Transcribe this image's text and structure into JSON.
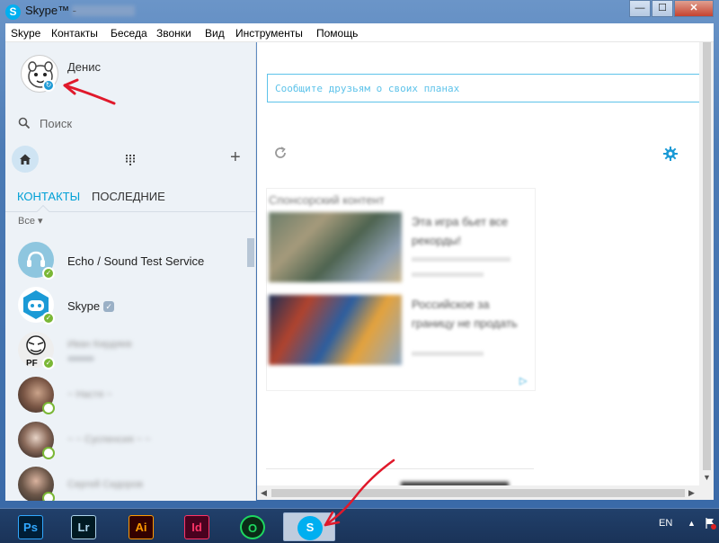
{
  "window": {
    "title": "Skype™ - ",
    "controls": {
      "minimize": "—",
      "maximize": "☐",
      "close": "✕"
    }
  },
  "menu": [
    "Skype",
    "Контакты",
    "Беседа",
    "Звонки",
    "Вид",
    "Инструменты",
    "Помощь"
  ],
  "profile": {
    "name": "Денис"
  },
  "search": {
    "placeholder": "Поиск"
  },
  "tabs": {
    "contacts": "КОНТАКТЫ",
    "recent": "ПОСЛЕДНИЕ"
  },
  "filter": "Все ▾",
  "contacts": [
    {
      "name": "Echo / Sound Test Service",
      "status": "online"
    },
    {
      "name": "Skype",
      "status": "online",
      "verified": true
    },
    {
      "name": "Иван Кирдяев",
      "status": "online",
      "blurred": true
    },
    {
      "name": "~ Настя ~",
      "status": "offline",
      "blurred": true
    },
    {
      "name": "~ ~ Суспенсия ~ ~",
      "status": "offline",
      "blurred": true
    },
    {
      "name": "Сергей Сидоров",
      "status": "offline",
      "blurred": true
    }
  ],
  "main": {
    "mood_placeholder": "Сообщите друзьям о своих планах",
    "sponsored_title": "Спонсорский контент",
    "ads": [
      {
        "headline": "Эта игра бьет все рекорды!",
        "source": "Lorem ipsum"
      },
      {
        "headline": "Российское за границу не продать",
        "source": "Lorem ipsum"
      }
    ]
  },
  "taskbar": {
    "apps": [
      {
        "label": "Ps",
        "color": "#31a8ff",
        "bg": "#001e36"
      },
      {
        "label": "Lr",
        "color": "#add5ec",
        "bg": "#001a23"
      },
      {
        "label": "Ai",
        "color": "#ff9a00",
        "bg": "#330000"
      },
      {
        "label": "Id",
        "color": "#ff3366",
        "bg": "#49021f"
      },
      {
        "label": "O",
        "color": "#1ed760",
        "bg": "#0b2b17"
      },
      {
        "label": "S",
        "color": "#ffffff",
        "bg": "#00aff0"
      }
    ],
    "language": "EN"
  },
  "colors": {
    "accent": "#00a0d6",
    "online": "#7ab735",
    "annotation": "#e0192b"
  }
}
